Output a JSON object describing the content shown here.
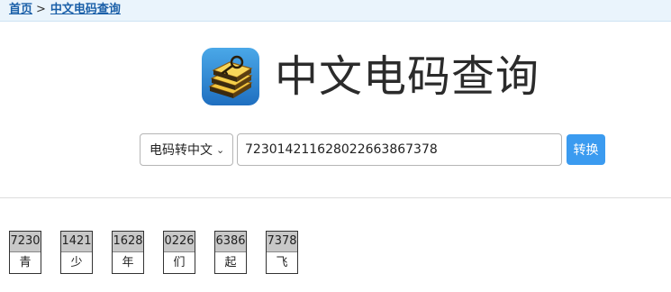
{
  "breadcrumb": {
    "home_label": "首页",
    "separator": ">",
    "current_label": "中文电码查询"
  },
  "header": {
    "title": "中文电码查询",
    "logo_icon": "book-key-icon"
  },
  "search": {
    "mode_selected": "电码转中文",
    "input_value": "723014211628022663867378",
    "button_label": "转换"
  },
  "results": [
    {
      "code": "7230",
      "char": "青"
    },
    {
      "code": "1421",
      "char": "少"
    },
    {
      "code": "1628",
      "char": "年"
    },
    {
      "code": "0226",
      "char": "们"
    },
    {
      "code": "6386",
      "char": "起"
    },
    {
      "code": "7378",
      "char": "飞"
    }
  ],
  "colors": {
    "accent": "#3b9bf0",
    "link": "#1a5fa8",
    "breadcrumb_bg": "#eaf4fc",
    "code_cell_bg": "#c8c8c8"
  }
}
